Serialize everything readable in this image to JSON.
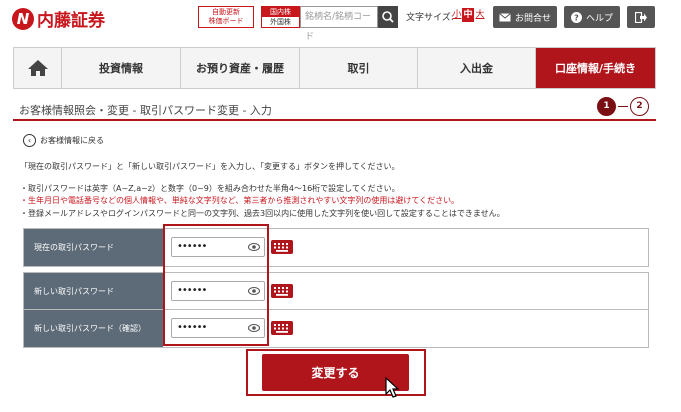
{
  "header": {
    "logo_text": "内藤証券",
    "auto_update": "自動更新\n株価ボード",
    "market_top": "国内株",
    "market_bottom": "外国株",
    "search_placeholder": "銘柄名/銘柄コード",
    "fontsize_label": "文字サイズ:",
    "fontsize_small": "小",
    "fontsize_medium": "中",
    "fontsize_large": "大",
    "contact": "お問合せ",
    "help": "ヘルプ"
  },
  "nav": {
    "items": [
      "投資情報",
      "お預り資産・履歴",
      "取引",
      "入出金",
      "口座情報/手続き"
    ]
  },
  "page": {
    "title": "お客様情報照会・変更 - 取引パスワード変更 - 入力",
    "steps": [
      "1",
      "2"
    ],
    "back_label": "お客様情報に戻る",
    "instruction": "「現在の取引パスワード」と「新しい取引パスワード」を入力し、「変更する」ボタンを押してください。",
    "note1": "・取引パスワードは英字（A~Z,a~z）と数字（0~9）を組み合わせた半角4～16桁で設定してください。",
    "note2": "・生年月日や電話番号などの個人情報や、単純な文字列など、第三者から推測されやすい文字列の使用は避けてください。",
    "note3": "・登録メールアドレスやログインパスワードと同一の文字列、過去3回以内に使用した文字列を使い回して設定することはできません。"
  },
  "form": {
    "current_label": "現在の取引パスワード",
    "current_value": "••••••",
    "new_label": "新しい取引パスワード",
    "new_value": "••••••",
    "confirm_label": "新しい取引パスワード（確認）",
    "confirm_value": "••••••",
    "submit_label": "変更する"
  }
}
